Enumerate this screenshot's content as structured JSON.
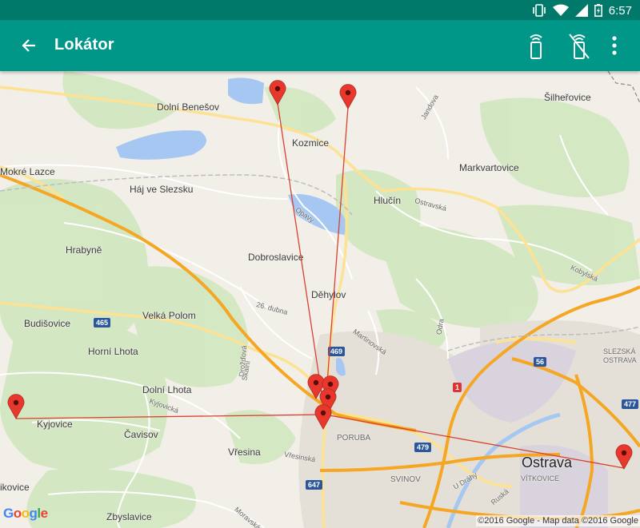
{
  "status_bar": {
    "time": "6:57",
    "icons": [
      "vibrate-icon",
      "wifi-icon",
      "signal-icon",
      "battery-charging-icon"
    ]
  },
  "app_bar": {
    "title": "Lokátor",
    "actions": [
      "phone-wifi-icon",
      "phone-wifi-off-icon",
      "overflow-menu-icon"
    ]
  },
  "map": {
    "places": {
      "dolni_benesov": "Dolní Benešov",
      "kozmice": "Kozmice",
      "silherovice": "Šilheřovice",
      "mokre_lazce": "Mokré Lazce",
      "haj": "Háj ve Slezsku",
      "hlucin": "Hlučín",
      "markvartovice": "Markvartovice",
      "hrabyne": "Hrabyně",
      "dobroslavice": "Dobroslavice",
      "dehylov": "Děhylov",
      "budisovice": "Budišovice",
      "velka_polom": "Velká Polom",
      "horni_lhota": "Horní Lhota",
      "dolni_lhota": "Dolní Lhota",
      "kyjovice": "Kyjovice",
      "cavisov": "Čavisov",
      "vresina": "Vřesina",
      "kovice": "ikovice",
      "zbyslavice": "Zbyslavice",
      "poruba": "PORUBA",
      "svinov": "SVINOV",
      "ostrava": "Ostrava",
      "vitkovice": "VÍTKOVICE",
      "slezska_ostrava": "SLEZSKÁ OSTRAVA"
    },
    "road_labels": {
      "jandova": "Jandova",
      "ostravska": "Ostravská",
      "opavy": "Opavy",
      "kobylska": "Kobylská",
      "dubna": "26. dubna",
      "martinovska": "Martinovská",
      "drozdovska": "Drožďová",
      "kyjovicka": "Kyjovická",
      "vresinska": "Vřesinská",
      "skalni": "Skalní",
      "odra": "Odra",
      "ruska": "Ruská",
      "udrahy": "U Dráhy",
      "moravska": "Moravská"
    },
    "road_shields": {
      "r465": "465",
      "r469": "469",
      "r56": "56",
      "r1": "1",
      "r479": "479",
      "r477": "477",
      "r647": "647"
    },
    "attribution": {
      "logo": "Google",
      "copyright": "©2016 Google - Map data ©2016 Google"
    }
  },
  "colors": {
    "statusbar": "#00796b",
    "appbar": "#009688",
    "marker": "#e8372c",
    "line": "#d9412f"
  }
}
